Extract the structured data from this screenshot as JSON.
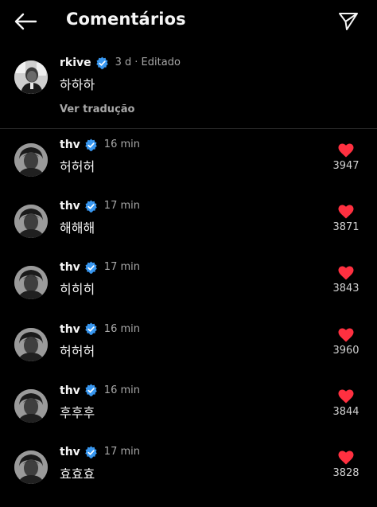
{
  "header": {
    "title": "Comentários",
    "back_icon": "arrow-left-icon",
    "send_icon": "paper-plane-icon"
  },
  "colors": {
    "background": "#000000",
    "verified": "#3897f0",
    "heart": "#ff3040",
    "meta": "#a8a8a8"
  },
  "main_comment": {
    "username": "rkive",
    "time": "3 d",
    "edited": "· Editado",
    "text": "하하하",
    "translate_label": "Ver tradução"
  },
  "comments": [
    {
      "username": "thv",
      "time": "16 min",
      "text": "허허허",
      "likes": "3947"
    },
    {
      "username": "thv",
      "time": "17 min",
      "text": "해해해",
      "likes": "3871"
    },
    {
      "username": "thv",
      "time": "17 min",
      "text": "히히히",
      "likes": "3843"
    },
    {
      "username": "thv",
      "time": "16 min",
      "text": "허허허",
      "likes": "3960"
    },
    {
      "username": "thv",
      "time": "16 min",
      "text": "후후후",
      "likes": "3844"
    },
    {
      "username": "thv",
      "time": "17 min",
      "text": "효효효",
      "likes": "3828"
    }
  ]
}
